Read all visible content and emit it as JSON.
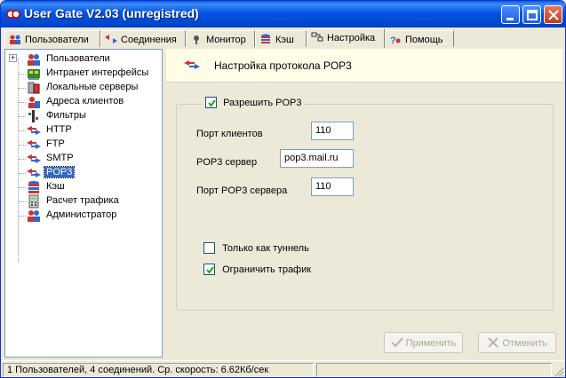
{
  "window": {
    "title": "User Gate V2.03 (unregistred)",
    "colors": {
      "titlebar": "#0054e3",
      "selection": "#316ac5",
      "face": "#ece9d8"
    }
  },
  "tabs": [
    {
      "label": "Пользователи",
      "icon": "users-icon"
    },
    {
      "label": "Соединения",
      "icon": "connections-arrows-icon"
    },
    {
      "label": "Монитор",
      "icon": "monitor-icon"
    },
    {
      "label": "Кэш",
      "icon": "cache-icon"
    },
    {
      "label": "Настройка",
      "icon": "settings-icon",
      "active": true
    },
    {
      "label": "Помощь",
      "icon": "help-icon"
    }
  ],
  "tree": {
    "items": [
      {
        "label": "Пользователи",
        "icon": "users-icon"
      },
      {
        "label": "Интранет интерфейсы",
        "icon": "network-card-icon"
      },
      {
        "label": "Локальные серверы",
        "icon": "servers-icon"
      },
      {
        "label": "Адреса клиентов",
        "icon": "client-address-icon"
      },
      {
        "label": "Фильтры",
        "icon": "filter-icon"
      },
      {
        "label": "HTTP",
        "icon": "protocol-arrows-icon"
      },
      {
        "label": "FTP",
        "icon": "protocol-arrows-icon"
      },
      {
        "label": "SMTP",
        "icon": "protocol-arrows-icon"
      },
      {
        "label": "POP3",
        "icon": "protocol-arrows-icon",
        "selected": true
      },
      {
        "label": "Кэш",
        "icon": "cache-icon"
      },
      {
        "label": "Расчет трафика",
        "icon": "calculator-icon"
      },
      {
        "label": "Администратор",
        "icon": "admin-icon"
      }
    ]
  },
  "panel": {
    "header": "Настройка протокола POP3",
    "enable_label": "Разрешить POP3",
    "enable_checked": true,
    "fields": [
      {
        "label": "Порт клиентов",
        "value": "110"
      },
      {
        "label": "POP3 сервер",
        "value": "pop3.mail.ru"
      },
      {
        "label": "Порт POP3 сервера",
        "value": "110"
      }
    ],
    "options": [
      {
        "label": "Только как туннель",
        "checked": false
      },
      {
        "label": "Ограничить трафик",
        "checked": true
      }
    ]
  },
  "buttons": {
    "apply": "Применить",
    "cancel": "Отменить"
  },
  "status": {
    "text": "1 Пользователей, 4 соединений. Ср. скорость: 6.62Кб/сек"
  }
}
